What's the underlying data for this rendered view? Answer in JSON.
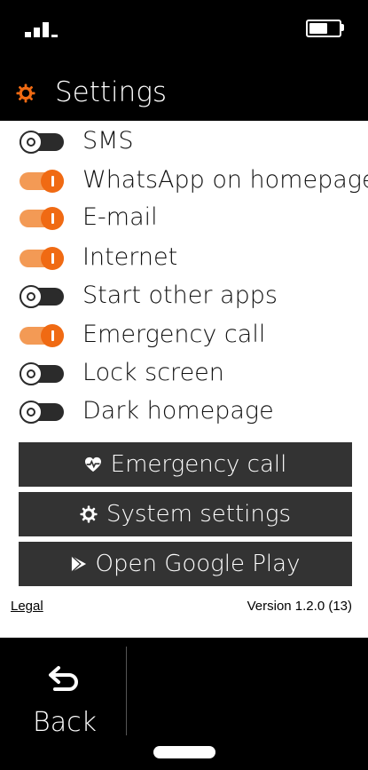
{
  "header": {
    "title": "Settings"
  },
  "toggles": [
    {
      "label": "SMS",
      "state": "off"
    },
    {
      "label": "WhatsApp on homepage",
      "state": "on"
    },
    {
      "label": "E-mail",
      "state": "on"
    },
    {
      "label": "Internet",
      "state": "on"
    },
    {
      "label": "Start other apps",
      "state": "off"
    },
    {
      "label": "Emergency call",
      "state": "on"
    },
    {
      "label": "Lock screen",
      "state": "off"
    },
    {
      "label": "Dark homepage",
      "state": "off"
    }
  ],
  "buttons": {
    "emergency": {
      "label": "Emergency call",
      "icon": "heart-pulse-icon"
    },
    "system": {
      "label": "System settings",
      "icon": "gear-icon"
    },
    "play": {
      "label": "Open Google Play",
      "icon": "play-store-icon"
    }
  },
  "footer": {
    "legal": "Legal",
    "version": "Version 1.2.0 (13)"
  },
  "nav": {
    "back_label": "Back"
  },
  "colors": {
    "accent": "#f06a13",
    "accent_light": "#f39a55",
    "button_bg": "#333333"
  }
}
